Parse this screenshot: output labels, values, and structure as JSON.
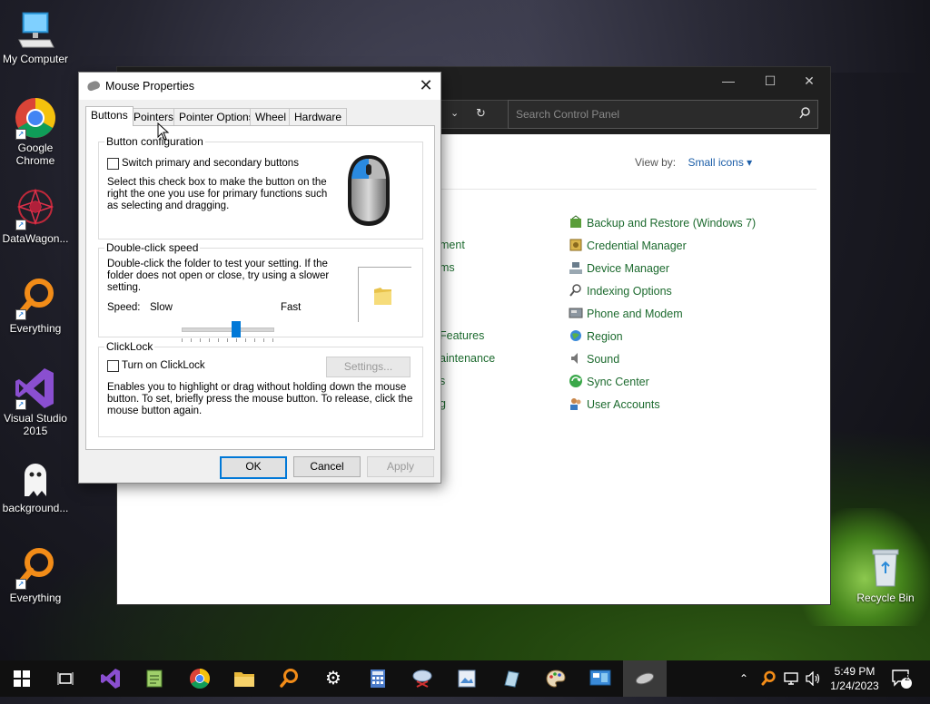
{
  "desktop": {
    "icons": [
      {
        "label": "My Computer"
      },
      {
        "label": "Google Chrome"
      },
      {
        "label": "DataWagon..."
      },
      {
        "label": "Everything"
      },
      {
        "label": "Visual Studio 2015"
      },
      {
        "label": "background..."
      },
      {
        "label": "Everything"
      }
    ],
    "recycle_bin": "Recycle Bin"
  },
  "control_panel": {
    "search_placeholder": "Search Control Panel",
    "view_by_label": "View by:",
    "view_by_value": "Small icons",
    "partial_left_items": [
      "ment",
      "ms",
      "Features",
      "aintenance",
      "s",
      "g"
    ],
    "items": [
      "Backup and Restore (Windows 7)",
      "Credential Manager",
      "Device Manager",
      "Indexing Options",
      "Phone and Modem",
      "Region",
      "Sound",
      "Sync Center",
      "User Accounts"
    ]
  },
  "dialog": {
    "title": "Mouse Properties",
    "tabs": [
      "Buttons",
      "Pointers",
      "Pointer Options",
      "Wheel",
      "Hardware"
    ],
    "active_tab": "Buttons",
    "button_config": {
      "title": "Button configuration",
      "checkbox_label": "Switch primary and secondary buttons",
      "checked": false,
      "description_lines": [
        "Select this check box to make the button on the",
        "right the one you use for primary functions such",
        "as selecting and dragging."
      ]
    },
    "double_click": {
      "title": "Double-click speed",
      "description_lines": [
        "Double-click the folder to test your setting. If the",
        "folder does not open or close, try using a slower",
        "setting."
      ],
      "speed_label": "Speed:",
      "slow_label": "Slow",
      "fast_label": "Fast",
      "speed_value": 0.6
    },
    "clicklock": {
      "title": "ClickLock",
      "checkbox_label": "Turn on ClickLock",
      "checked": false,
      "settings_button": "Settings...",
      "description_lines": [
        "Enables you to highlight or drag without holding down the mouse",
        "button. To set, briefly press the mouse button. To release, click the",
        "mouse button again."
      ]
    },
    "buttons": {
      "ok": "OK",
      "cancel": "Cancel",
      "apply": "Apply"
    }
  },
  "taskbar": {
    "time": "5:49 PM",
    "date": "1/24/2023",
    "notification_count": "2"
  },
  "colors": {
    "accent": "#0078d7",
    "link_green": "#1c6a2e",
    "taskbar_bg": "#101010"
  }
}
